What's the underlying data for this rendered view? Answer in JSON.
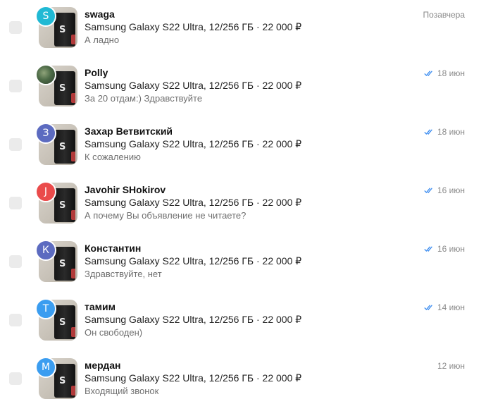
{
  "chats": [
    {
      "name": "swaga",
      "avatar_letter": "S",
      "avatar_color": "#20b9d4",
      "product": "Samsung Galaxy S22 Ultra, 12/256 ГБ · 22 000 ₽",
      "message": "А ладно",
      "date": "Позавчера",
      "read": false
    },
    {
      "name": "Polly",
      "avatar_letter": "",
      "avatar_color": "#4d6b47",
      "product": "Samsung Galaxy S22 Ultra, 12/256 ГБ · 22 000 ₽",
      "message": "За 20 отдам:) Здравствуйте",
      "date": "18 июн",
      "read": true
    },
    {
      "name": "Захар Ветвитский",
      "avatar_letter": "З",
      "avatar_color": "#5c6bc0",
      "product": "Samsung Galaxy S22 Ultra, 12/256 ГБ · 22 000 ₽",
      "message": "К сожалению",
      "date": "18 июн",
      "read": true
    },
    {
      "name": "Javohir SHokirov",
      "avatar_letter": "J",
      "avatar_color": "#ea4b4b",
      "product": "Samsung Galaxy S22 Ultra, 12/256 ГБ · 22 000 ₽",
      "message": "А почему Вы объявление не читаете?",
      "date": "16 июн",
      "read": true
    },
    {
      "name": "Константин",
      "avatar_letter": "К",
      "avatar_color": "#5c6bc0",
      "product": "Samsung Galaxy S22 Ultra, 12/256 ГБ · 22 000 ₽",
      "message": "Здравствуйте, нет",
      "date": "16 июн",
      "read": true
    },
    {
      "name": "тамим",
      "avatar_letter": "Т",
      "avatar_color": "#3b9df0",
      "product": "Samsung Galaxy S22 Ultra, 12/256 ГБ · 22 000 ₽",
      "message": "Он свободен)",
      "date": "14 июн",
      "read": true
    },
    {
      "name": "мердан",
      "avatar_letter": "М",
      "avatar_color": "#3b9df0",
      "product": "Samsung Galaxy S22 Ultra, 12/256 ГБ · 22 000 ₽",
      "message": "Входящий звонок",
      "date": "12 июн",
      "read": false
    }
  ],
  "colors": {
    "read_check": "#3b8cf0",
    "checkbox_bg": "#ebebeb",
    "message_text": "#6f6f6f",
    "date_text": "#8a8a8a"
  }
}
